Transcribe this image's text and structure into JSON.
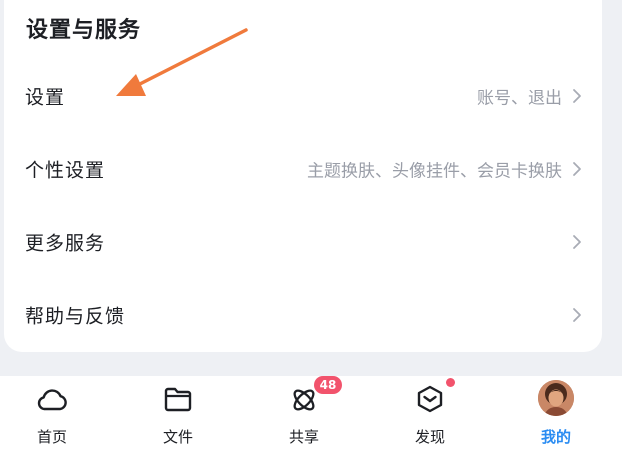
{
  "settings": {
    "title": "设置与服务",
    "rows": [
      {
        "label": "设置",
        "hint": "账号、退出"
      },
      {
        "label": "个性设置",
        "hint": "主题换肤、头像挂件、会员卡换肤"
      },
      {
        "label": "更多服务",
        "hint": ""
      },
      {
        "label": "帮助与反馈",
        "hint": ""
      }
    ]
  },
  "tabbar": {
    "tabs": [
      {
        "label": "首页",
        "icon": "cloud-icon"
      },
      {
        "label": "文件",
        "icon": "folder-icon"
      },
      {
        "label": "共享",
        "icon": "atom-icon",
        "badge": "48"
      },
      {
        "label": "发现",
        "icon": "hexagon-icon"
      },
      {
        "label": "我的",
        "icon": "avatar",
        "active": true
      }
    ]
  },
  "colors": {
    "accent": "#2a8cf2",
    "annotation_arrow": "#f07a3c",
    "badge": "#f2536c"
  }
}
